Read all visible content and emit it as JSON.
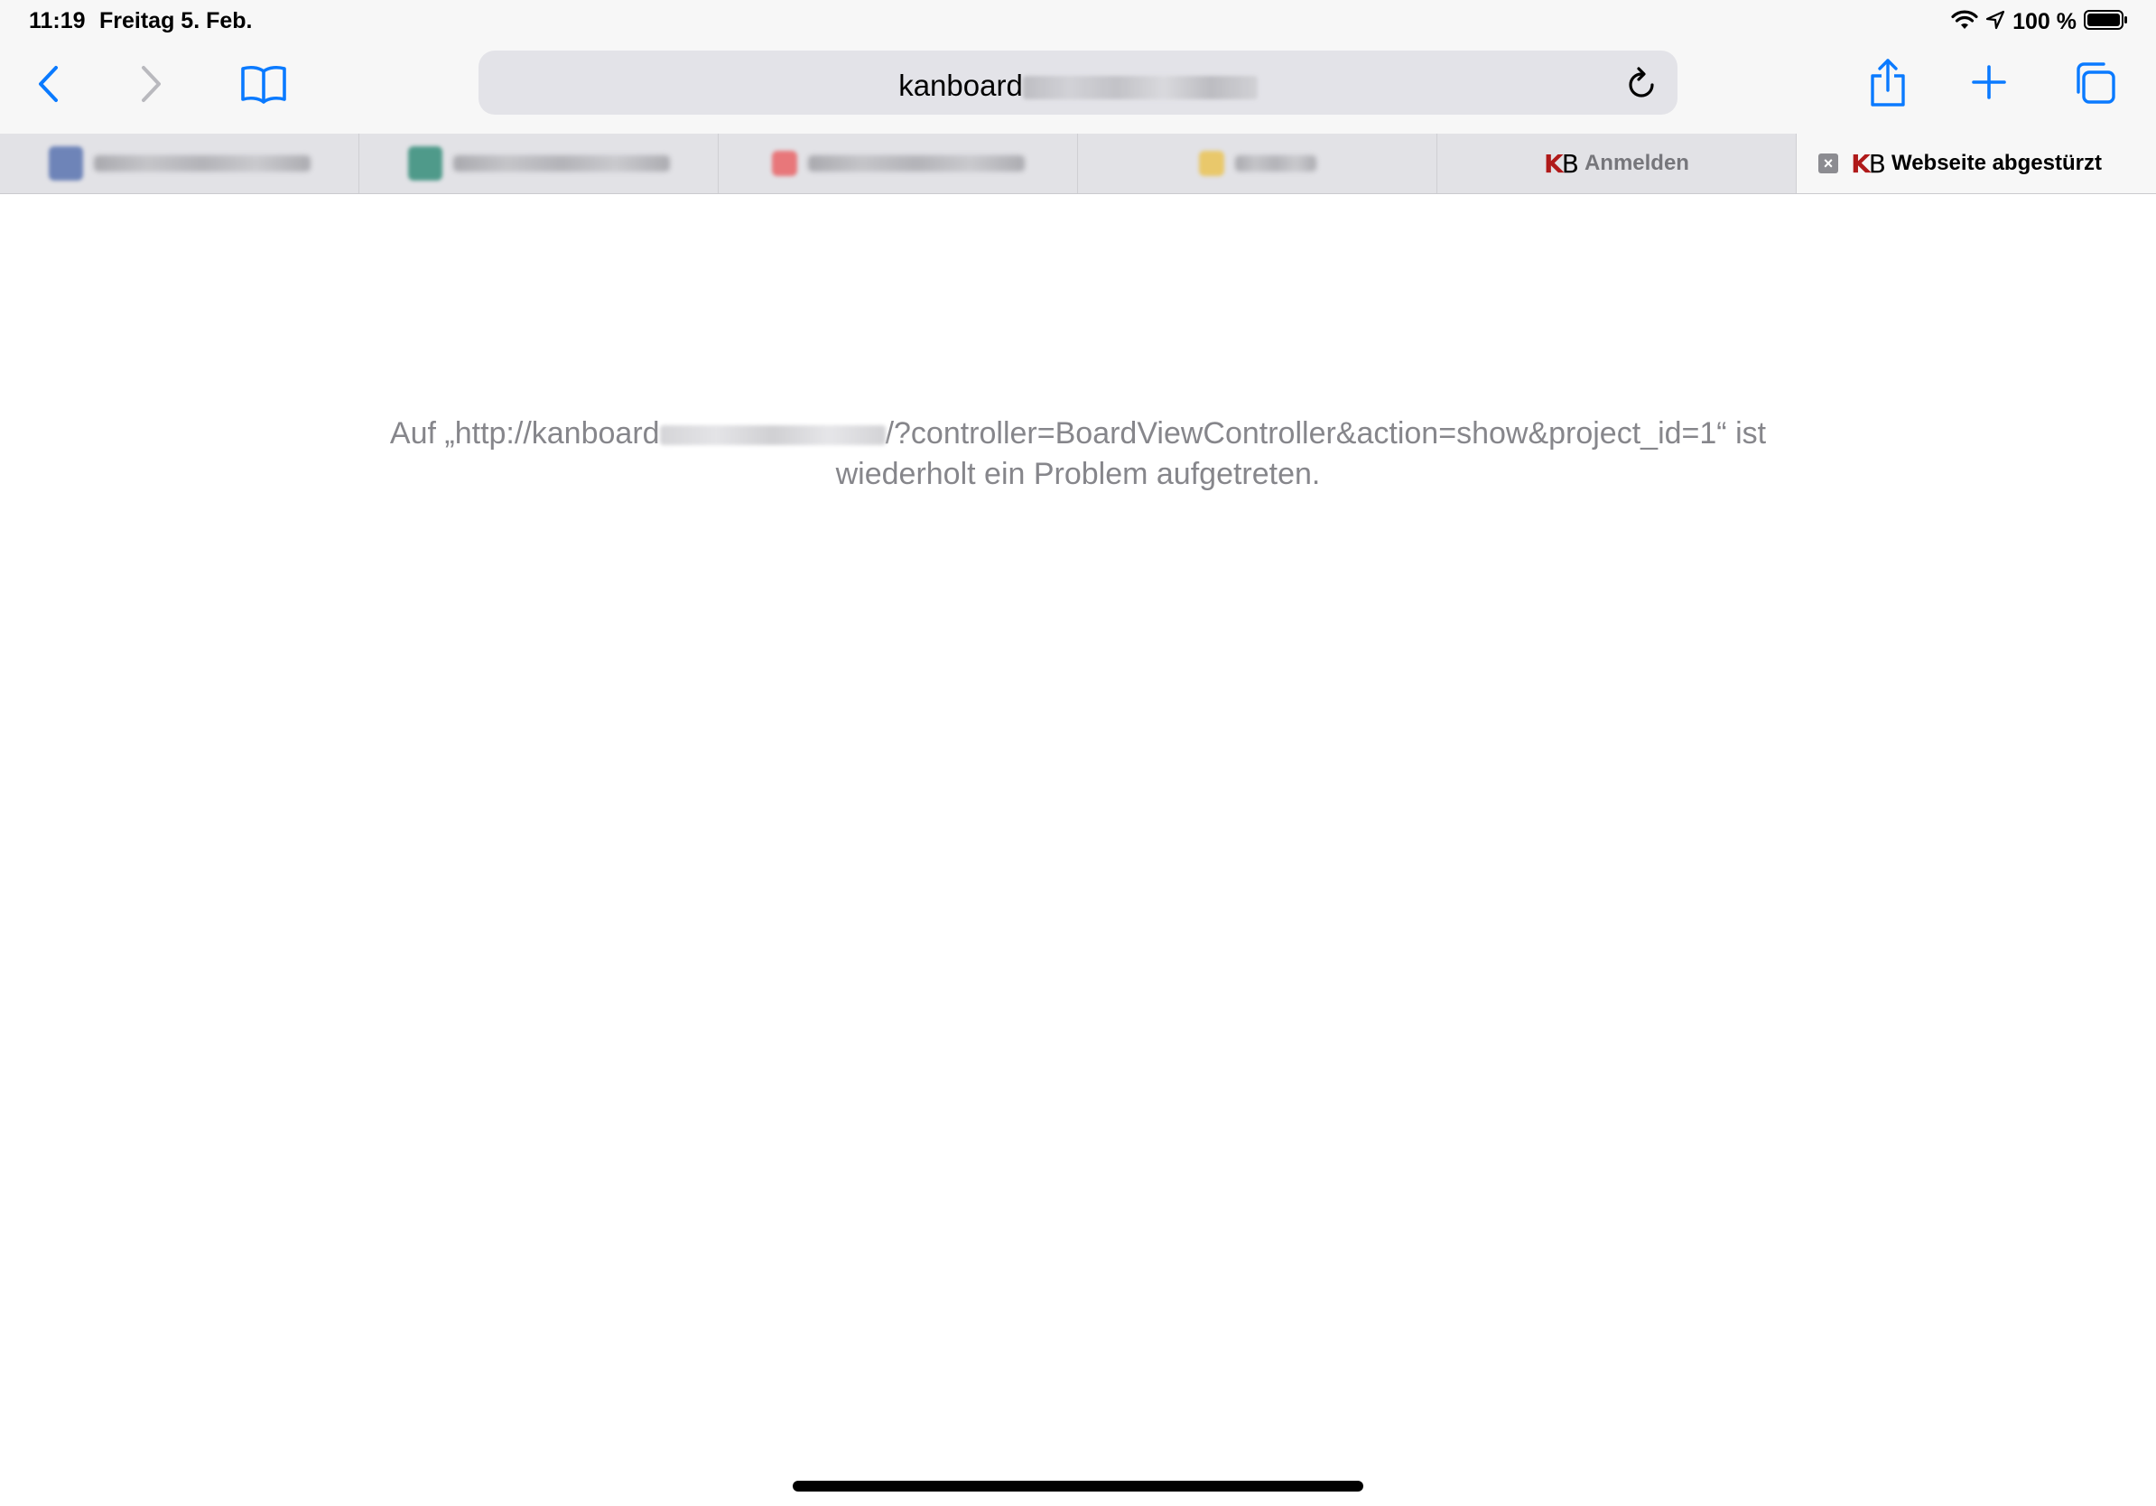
{
  "status_bar": {
    "time": "11:19",
    "date": "Freitag 5. Feb.",
    "battery": "100 %",
    "icons": [
      "wifi-icon",
      "location-arrow-icon",
      "battery-icon"
    ]
  },
  "toolbar": {
    "url_visible": "kanboard",
    "icons": [
      "chevron-left-icon",
      "chevron-right-icon",
      "book-icon",
      "reload-icon",
      "share-icon",
      "plus-icon",
      "tabs-icon"
    ],
    "accent_color": "#0a7aff"
  },
  "tabs": [
    {
      "label": "",
      "favicon_color": "#6e84b8",
      "active": false
    },
    {
      "label": "",
      "favicon_color": "#4f9a8a",
      "active": false
    },
    {
      "label": "",
      "favicon_color": "#e8777a",
      "active": false
    },
    {
      "label": "",
      "favicon_color": "#e9c86b",
      "active": false
    },
    {
      "label": "Anmelden",
      "favicon": "KB",
      "active": false
    },
    {
      "label": "Webseite abgestürzt",
      "favicon": "KB",
      "active": true
    }
  ],
  "content": {
    "message_prefix": "Auf „http://kanboard",
    "message_suffix": "/?controller=BoardViewController&action=show&project_id=1“ ist",
    "message_line2": "wiederholt ein Problem aufgetreten."
  }
}
